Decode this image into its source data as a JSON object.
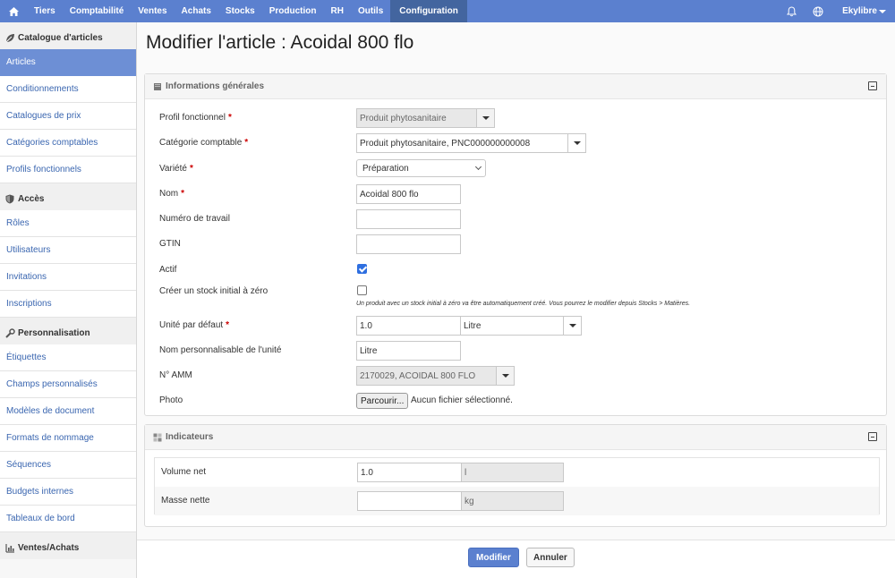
{
  "topnav": {
    "items": [
      "Tiers",
      "Comptabilité",
      "Ventes",
      "Achats",
      "Stocks",
      "Production",
      "RH",
      "Outils",
      "Configuration"
    ],
    "active": "Configuration",
    "user": "Ekylibre",
    "icons": [
      "home-icon",
      "bell-icon",
      "globe-icon",
      "caret-down-icon"
    ]
  },
  "sidebar": {
    "sections": [
      {
        "title": "Catalogue d'articles",
        "icon": "leaf-icon",
        "items": [
          "Articles",
          "Conditionnements",
          "Catalogues de prix",
          "Catégories comptables",
          "Profils fonctionnels"
        ]
      },
      {
        "title": "Accès",
        "icon": "shield-icon",
        "items": [
          "Rôles",
          "Utilisateurs",
          "Invitations",
          "Inscriptions"
        ]
      },
      {
        "title": "Personnalisation",
        "icon": "wrench-icon",
        "items": [
          "Étiquettes",
          "Champs personnalisés",
          "Modèles de document",
          "Formats de nommage",
          "Séquences",
          "Budgets internes",
          "Tableaux de bord"
        ]
      },
      {
        "title": "Ventes/Achats",
        "icon": "chart-icon",
        "items": []
      }
    ],
    "active_item": "Articles"
  },
  "page": {
    "title": "Modifier l'article : Acoidal 800 flo"
  },
  "general": {
    "title": "Informations générales",
    "required_mark": "*",
    "fields": {
      "profil": {
        "label": "Profil fonctionnel",
        "value": "Produit phytosanitaire"
      },
      "categorie": {
        "label": "Catégorie comptable",
        "value": "Produit phytosanitaire, PNC000000000008"
      },
      "variete": {
        "label": "Variété",
        "value": "Préparation"
      },
      "nom": {
        "label": "Nom",
        "value": "Acoidal 800 flo"
      },
      "numero": {
        "label": "Numéro de travail",
        "value": ""
      },
      "gtin": {
        "label": "GTIN",
        "value": ""
      },
      "actif": {
        "label": "Actif",
        "checked": true
      },
      "stock": {
        "label": "Créer un stock initial à zéro",
        "checked": false,
        "help": "Un produit avec un stock initial à zéro va être automatiquement créé. Vous pourrez le modifier depuis Stocks > Matières."
      },
      "unite": {
        "label": "Unité par défaut",
        "value": "1.0",
        "unit": "Litre"
      },
      "nom_unite": {
        "label": "Nom personnalisable de l'unité",
        "value": "Litre"
      },
      "amm": {
        "label": "N° AMM",
        "value": "2170029, ACOIDAL 800 FLO"
      },
      "photo": {
        "label": "Photo",
        "button": "Parcourir...",
        "status": "Aucun fichier sélectionné."
      }
    }
  },
  "indicateurs": {
    "title": "Indicateurs",
    "rows": [
      {
        "label": "Volume net",
        "value": "1.0",
        "unit": "l"
      },
      {
        "label": "Masse nette",
        "value": "",
        "unit": "kg"
      }
    ]
  },
  "actions": {
    "save": "Modifier",
    "cancel": "Annuler"
  },
  "colors": {
    "nav": "#5b80cf",
    "nav_active": "#43659f",
    "sidebar_active": "#6d8fd5",
    "link": "#3a66b0",
    "required": "#cc0000"
  }
}
